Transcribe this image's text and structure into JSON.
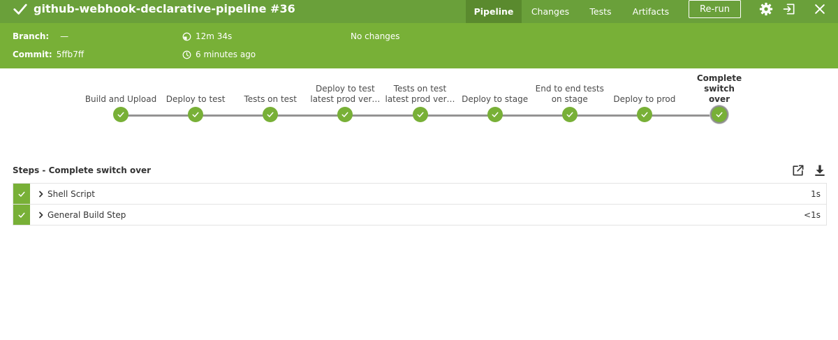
{
  "header": {
    "title": "github-webhook-declarative-pipeline #36",
    "tabs": {
      "pipeline": "Pipeline",
      "changes": "Changes",
      "tests": "Tests",
      "artifacts": "Artifacts"
    },
    "rerun_label": "Re-run",
    "icons": [
      "gear-icon",
      "exit-icon",
      "close-icon"
    ],
    "branch_label": "Branch:",
    "branch_value": "—",
    "commit_label": "Commit:",
    "commit_value": "5ffb7ff",
    "duration": "12m 34s",
    "started": "6 minutes ago",
    "changes": "No changes"
  },
  "pipeline": {
    "stages": [
      {
        "label": "Build and Upload",
        "status": "success"
      },
      {
        "label": "Deploy to test",
        "status": "success"
      },
      {
        "label": "Tests on test",
        "status": "success"
      },
      {
        "label": "Deploy to test\nlatest prod ver…",
        "status": "success"
      },
      {
        "label": "Tests on test\nlatest prod ver…",
        "status": "success"
      },
      {
        "label": "Deploy to stage",
        "status": "success"
      },
      {
        "label": "End to end tests\non stage",
        "status": "success"
      },
      {
        "label": "Deploy to prod",
        "status": "success"
      },
      {
        "label": "Complete switch\nover",
        "status": "success",
        "selected": true
      }
    ]
  },
  "steps": {
    "title": "Steps - Complete switch over",
    "items": [
      {
        "name": "Shell Script",
        "duration": "1s",
        "status": "success"
      },
      {
        "name": "General Build Step",
        "duration": "<1s",
        "status": "success"
      }
    ]
  },
  "colors": {
    "header_bg": "#78b037",
    "title_bar_bg": "#6aa03a",
    "active_tab_bg": "#5a8a2e",
    "success": "#78b037",
    "connector": "#949393"
  }
}
